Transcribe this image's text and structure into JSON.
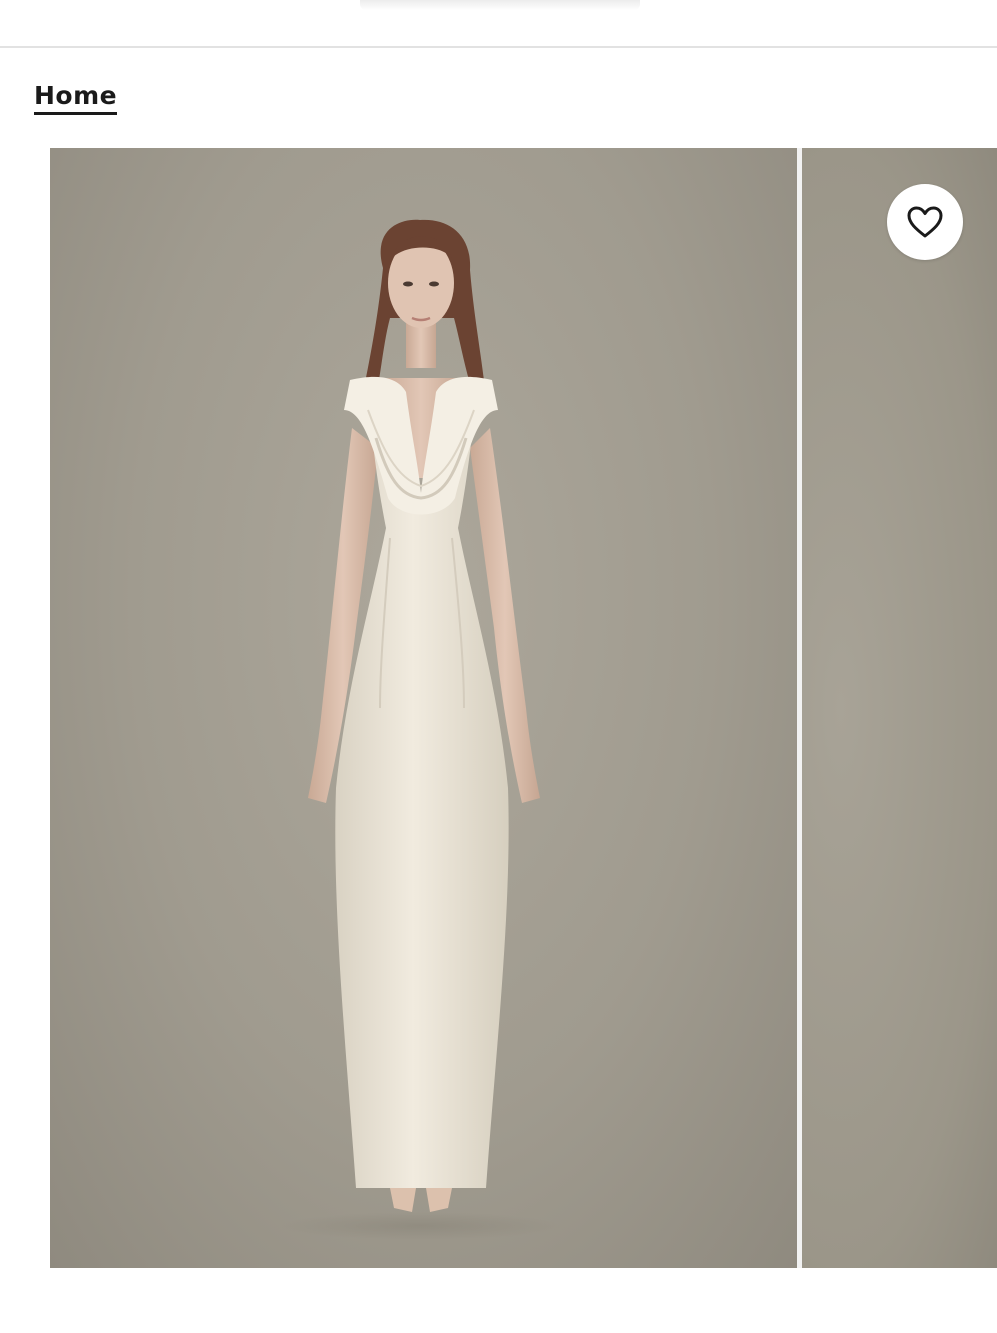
{
  "breadcrumb": {
    "home_label": "Home"
  },
  "gallery": {
    "favorite_icon": "heart-outline-icon",
    "colors": {
      "backdrop": "#a09b8f",
      "dress": "#efe9dc",
      "accent": "#1a1a1a"
    }
  }
}
